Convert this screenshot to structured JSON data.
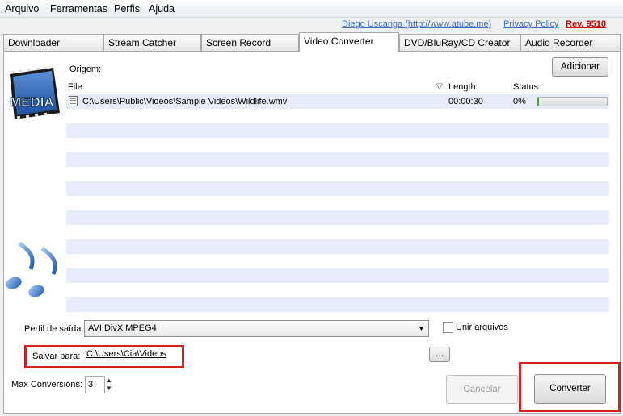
{
  "menu": [
    "Arquivo",
    "Ferramentas",
    "Perfis",
    "Ajuda"
  ],
  "links": {
    "author": "Diego Uscanga (http://www.atube.me)",
    "privacy": "Privacy Policy",
    "revision": "Rev. 9510"
  },
  "tabs": [
    "Downloader",
    "Stream Catcher",
    "Screen Record",
    "Video Converter",
    "DVD/BluRay/CD Creator",
    "Audio Recorder"
  ],
  "active_tab": "Video Converter",
  "origin_label": "Origem:",
  "add_button": "Adicionar",
  "logo_text": "MEDIA",
  "file_list": {
    "columns": [
      "File",
      "Length",
      "Status"
    ],
    "rows": [
      {
        "file": "C:\\Users\\Public\\Videos\\Sample Videos\\Wildlife.wmv",
        "length": "00:00:30",
        "status": "0%",
        "progress": 0.0
      }
    ]
  },
  "profile": {
    "label": "Perfil de saída",
    "value": "AVI DivX MPEG4"
  },
  "merge": {
    "label": "Unir arquivos",
    "checked": false
  },
  "save": {
    "label": "Salvar para:",
    "path": "C:\\Users\\Cia\\Videos",
    "browse": "..."
  },
  "max_conversions": {
    "label": "Max Conversions:",
    "value": "3"
  },
  "buttons": {
    "cancel": "Cancelar",
    "convert": "Converter"
  },
  "colors": {
    "link": "#3a6fc6",
    "revision": "#cc0000",
    "highlight": "#d42020",
    "stripe": "#e8ebfa",
    "progress": "#3cb043"
  }
}
